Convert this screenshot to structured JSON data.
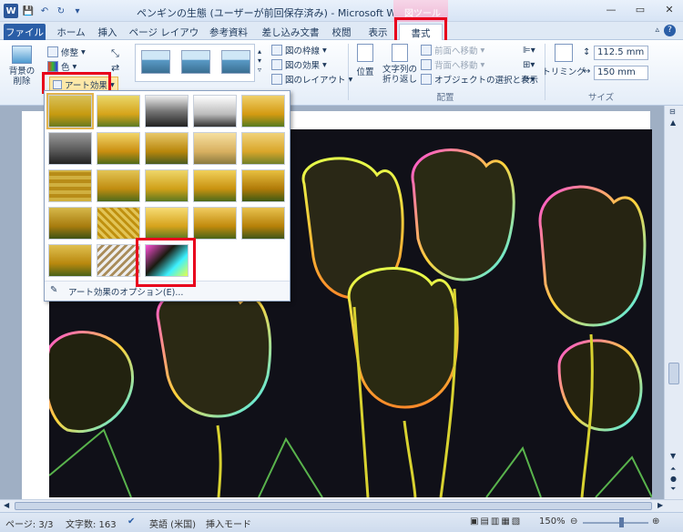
{
  "window": {
    "title": "ペンギンの生態 (ユーザーが前回保存済み) - Microsoft Word",
    "context_tab_group": "図ツール",
    "qat_icons": [
      "word-logo-icon",
      "save-icon",
      "undo-icon",
      "redo-icon",
      "customize-icon"
    ],
    "minimize": "—",
    "restore": "▭",
    "close": "✕"
  },
  "tabs": [
    "ファイル",
    "ホーム",
    "挿入",
    "ページ レイアウト",
    "参考資料",
    "差し込み文書",
    "校閲",
    "表示",
    "書式"
  ],
  "ribbon": {
    "remove_bg": "背景の\n削除",
    "corrections": "修整",
    "color": "色",
    "art_effects": "アート効果",
    "picture_border": "図の枠線",
    "picture_effects": "図の効果",
    "picture_layout": "図のレイアウト",
    "position": "位置",
    "wrap_text": "文字列の\n折り返し",
    "bring_forward": "前面へ移動",
    "send_backward": "背面へ移動",
    "selection_pane": "オブジェクトの選択と表示",
    "arrange_label": "配置",
    "crop": "トリミング",
    "height": "112.5 mm",
    "width": "150 mm",
    "size_label": "サイズ"
  },
  "dropdown": {
    "options_label": "アート効果のオプション(E)..."
  },
  "status": {
    "page": "ページ: 3/3",
    "words": "文字数: 163",
    "language": "英語 (米国)",
    "mode": "挿入モード",
    "zoom": "150%"
  },
  "colors": {
    "accent": "#2a5ea7",
    "highlight": "#e8001c"
  }
}
